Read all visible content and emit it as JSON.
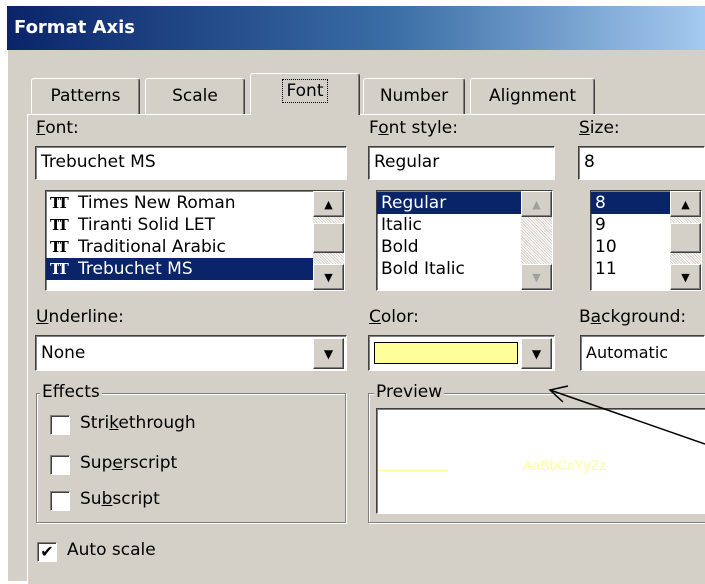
{
  "window": {
    "title": "Format Axis"
  },
  "tabs": [
    {
      "label": "Patterns"
    },
    {
      "label": "Scale"
    },
    {
      "label": "Font"
    },
    {
      "label": "Number"
    },
    {
      "label": "Alignment"
    }
  ],
  "font": {
    "label": "Font:",
    "value": "Trebuchet MS",
    "items": [
      "Times New Roman",
      "Tiranti Solid LET",
      "Traditional Arabic",
      "Trebuchet MS"
    ],
    "selected_index": 3,
    "icon": "truetype-icon"
  },
  "font_style": {
    "label": "Font style:",
    "value": "Regular",
    "items": [
      "Regular",
      "Italic",
      "Bold",
      "Bold Italic"
    ],
    "selected_index": 0
  },
  "size": {
    "label": "Size:",
    "value": "8",
    "items": [
      "8",
      "9",
      "10",
      "11"
    ],
    "selected_index": 0
  },
  "underline": {
    "label": "Underline:",
    "value": "None"
  },
  "color": {
    "label": "Color:",
    "swatch": "#ffff99"
  },
  "background": {
    "label": "Background:",
    "value": "Automatic"
  },
  "effects": {
    "title": "Effects",
    "items": [
      {
        "label": "Strikethrough",
        "checked": false
      },
      {
        "label": "Superscript",
        "checked": false
      },
      {
        "label": "Subscript",
        "checked": false
      }
    ]
  },
  "preview": {
    "title": "Preview",
    "sample": "AaBbCcYyZz",
    "sample_color": "#ffff99"
  },
  "auto_scale": {
    "label": "Auto scale",
    "checked": true
  },
  "colors": {
    "selection": "#0a246a",
    "dialog": "#d4d0c8",
    "title_start": "#0a246a",
    "title_end": "#a6caf0"
  }
}
